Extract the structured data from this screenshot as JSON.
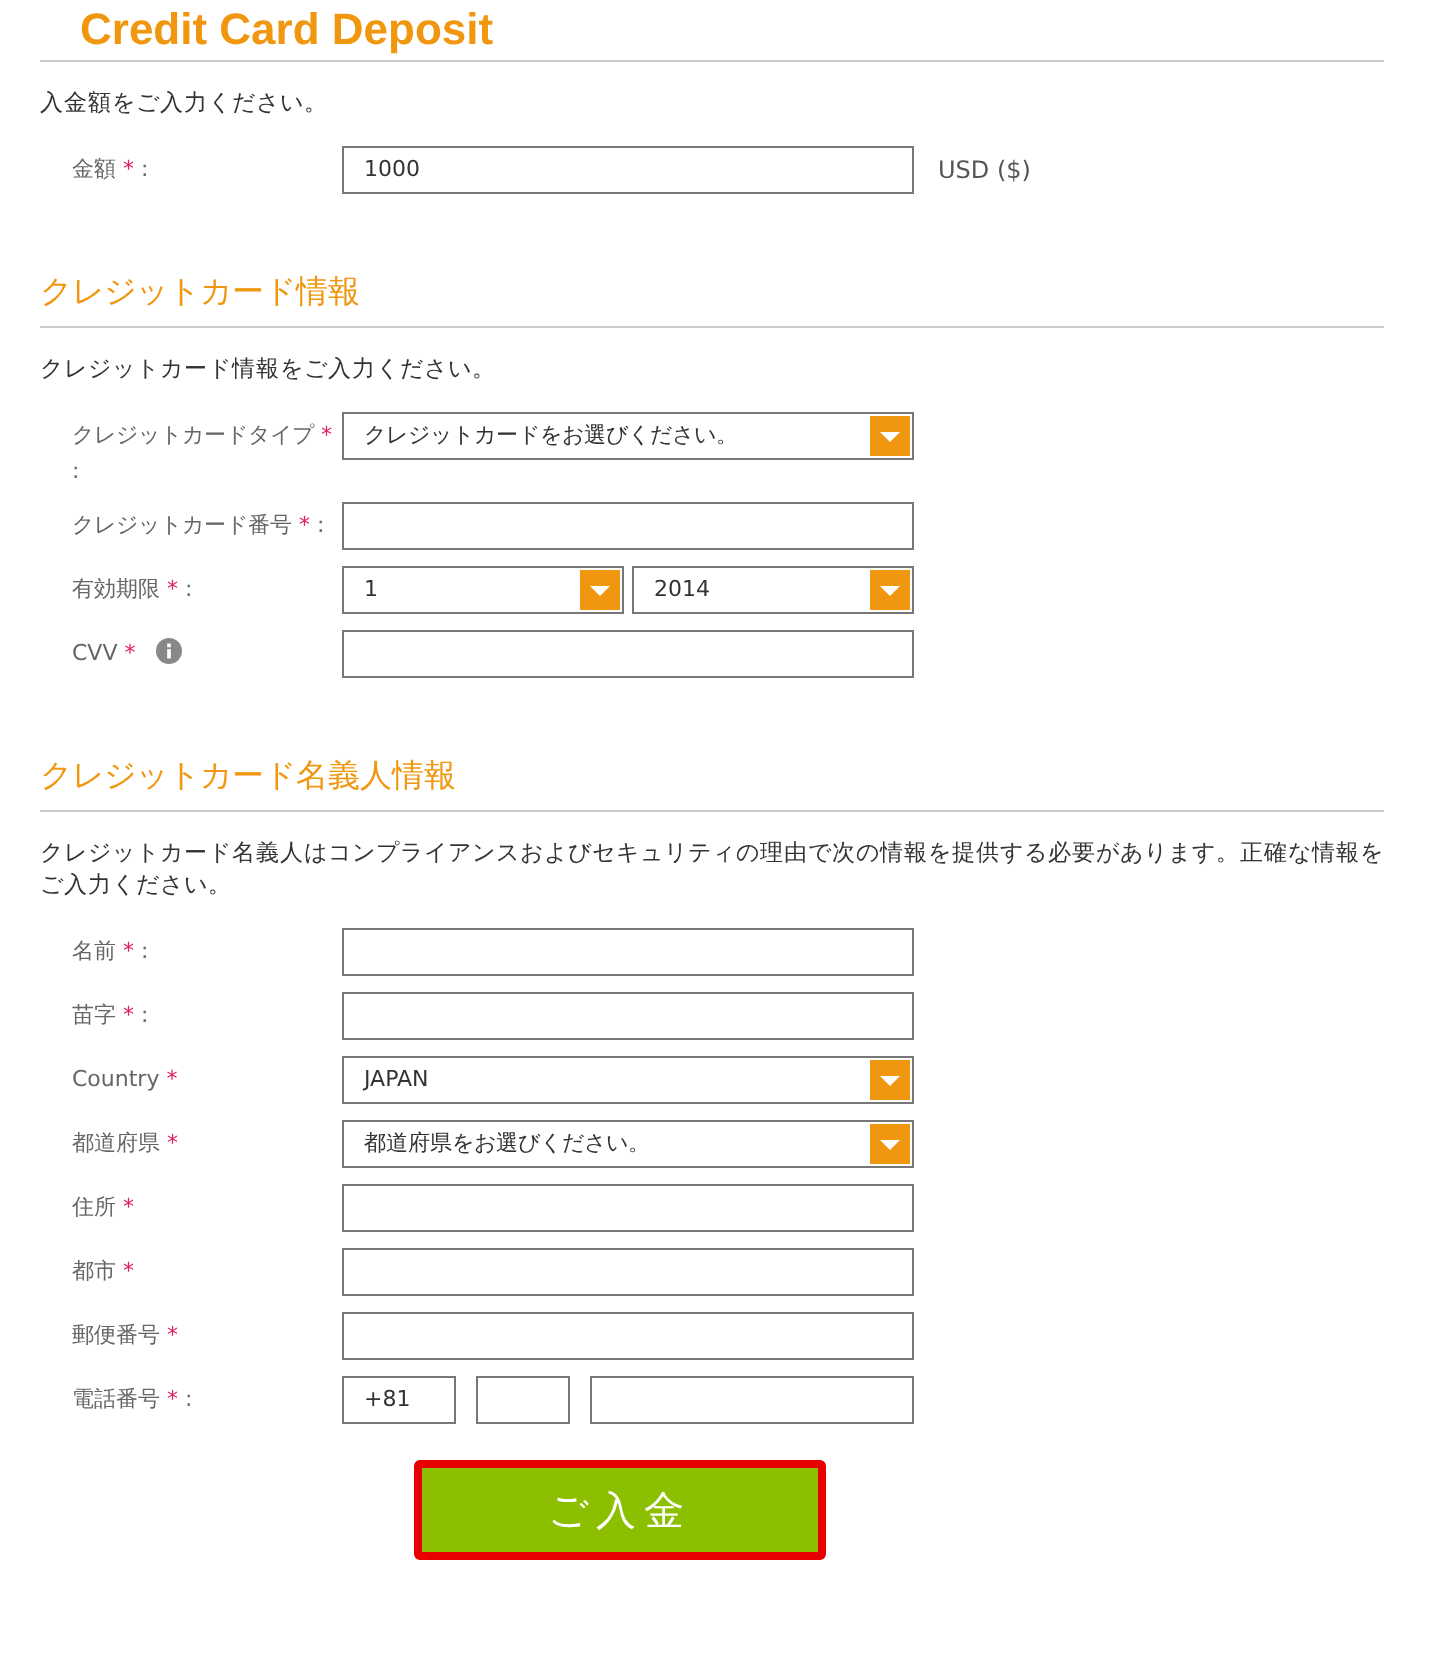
{
  "title": "Credit Card Deposit",
  "sections": [
    {
      "intro": "入金額をご入力ください。",
      "fields": [
        {
          "kind": "input",
          "label": "金額",
          "asterisk": "*",
          "colon": ":",
          "value": "1000",
          "unit": "USD ($)"
        }
      ]
    },
    {
      "heading": "クレジットカード情報",
      "intro": "クレジットカード情報をご入力ください。",
      "fields": [
        {
          "kind": "select",
          "label": "クレジットカードタイプ",
          "asterisk": "*",
          "colon": ":",
          "value": "クレジットカードをお選びください。"
        },
        {
          "kind": "input",
          "label": "クレジットカード番号",
          "asterisk": "*",
          "colon": ":"
        },
        {
          "kind": "select-pair",
          "label": "有効期限",
          "asterisk": "*",
          "colon": ":",
          "values": [
            "1",
            "2014"
          ]
        },
        {
          "kind": "input",
          "label": "CVV",
          "asterisk": "*",
          "info": true
        }
      ]
    },
    {
      "heading": "クレジットカード名義人情報",
      "intro": "クレジットカード名義人はコンプライアンスおよびセキュリティの理由で次の情報を提供する必要があります。正確な情報をご入力ください。",
      "fields": [
        {
          "kind": "input",
          "label": "名前",
          "asterisk": "*",
          "colon": ":"
        },
        {
          "kind": "input",
          "label": "苗字",
          "asterisk": "*",
          "colon": ":"
        },
        {
          "kind": "select",
          "label": "Country",
          "asterisk": "*",
          "value": "JAPAN"
        },
        {
          "kind": "select",
          "label": "都道府県",
          "asterisk": "*",
          "value": "都道府県をお選びください。"
        },
        {
          "kind": "input",
          "label": "住所",
          "asterisk": "*"
        },
        {
          "kind": "input",
          "label": "都市",
          "asterisk": "*"
        },
        {
          "kind": "input",
          "label": "郵便番号",
          "asterisk": "*"
        },
        {
          "kind": "phone",
          "label": "電話番号",
          "asterisk": "*",
          "colon": ":",
          "parts": [
            {
              "kind": "code",
              "value": "+81"
            },
            {
              "kind": "area"
            },
            {
              "kind": "number"
            }
          ]
        }
      ]
    }
  ],
  "submit": "ご入金"
}
